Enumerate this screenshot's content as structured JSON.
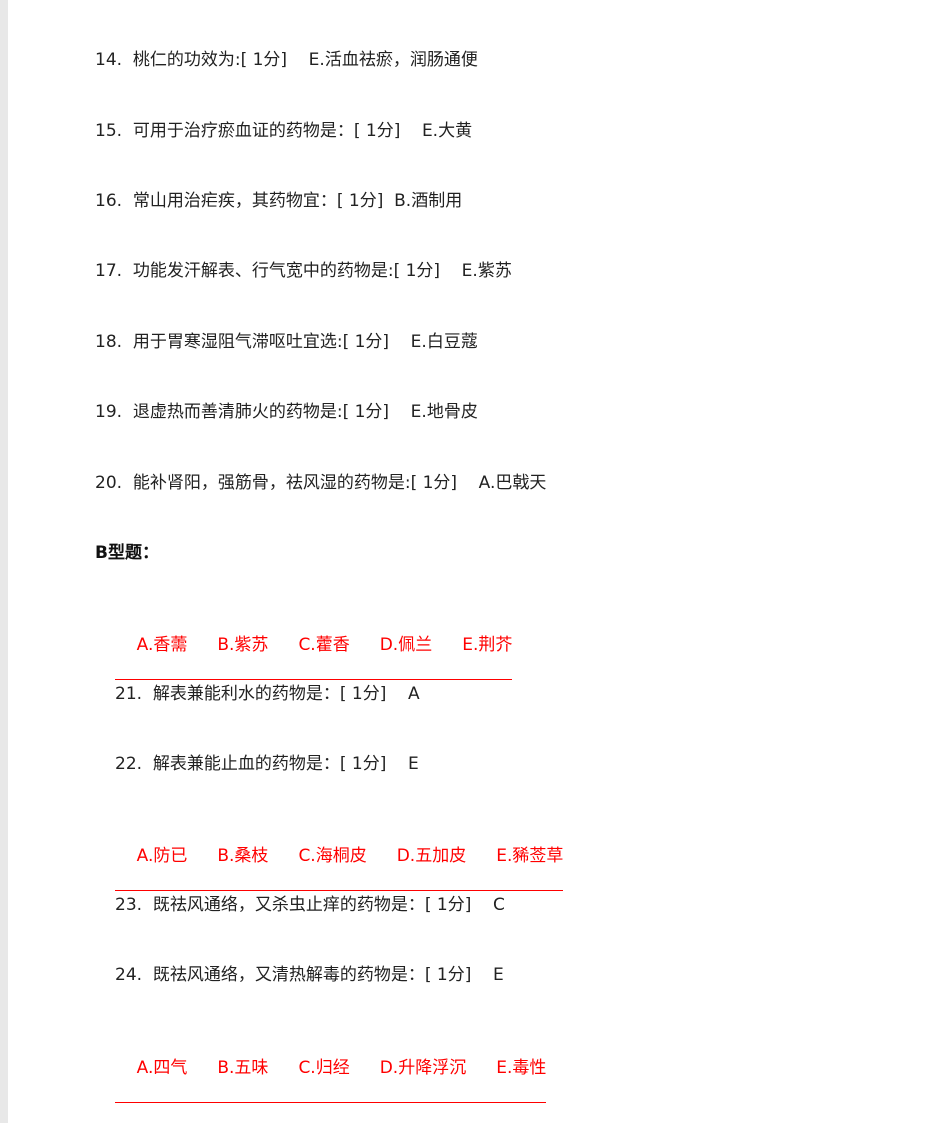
{
  "questions_a": [
    {
      "text": "14.  桃仁的功效为:[ 1分]    E.活血祛瘀，润肠通便"
    },
    {
      "text": "15.  可用于治疗瘀血证的药物是：[ 1分]    E.大黄"
    },
    {
      "text": "16.  常山用治疟疾，其药物宜：[ 1分]  B.酒制用"
    },
    {
      "text": "17.  功能发汗解表、行气宽中的药物是:[ 1分]    E.紫苏"
    },
    {
      "text": "18.  用于胃寒湿阻气滞呕吐宜选:[ 1分]    E.白豆蔻"
    },
    {
      "text": "19.  退虚热而善清肺火的药物是:[ 1分]    E.地骨皮"
    },
    {
      "text": "20.  能补肾阳，强筋骨，祛风湿的药物是:[ 1分]    A.巴戟天"
    }
  ],
  "section_b_title": "B型题：",
  "groups": [
    {
      "options": [
        "A.香薷",
        "B.紫苏",
        "C.藿香",
        "D.佩兰",
        "E.荆芥"
      ],
      "questions": [
        "21.  解表兼能利水的药物是：[ 1分]    A",
        "22.  解表兼能止血的药物是：[ 1分]    E"
      ]
    },
    {
      "options": [
        "A.防已",
        "B.桑枝",
        "C.海桐皮",
        "D.五加皮",
        "E.豨莶草"
      ],
      "questions": [
        "23.  既祛风通络，又杀虫止痒的药物是：[ 1分]    C",
        "24.  既祛风通络，又清热解毒的药物是：[ 1分]    E"
      ]
    },
    {
      "options": [
        "A.四气",
        "B.五味",
        "C.归经",
        "D.升降浮沉",
        "E.毒性"
      ],
      "questions": []
    }
  ],
  "colors": {
    "option_text": "#ff0000",
    "body_text": "#222222"
  }
}
